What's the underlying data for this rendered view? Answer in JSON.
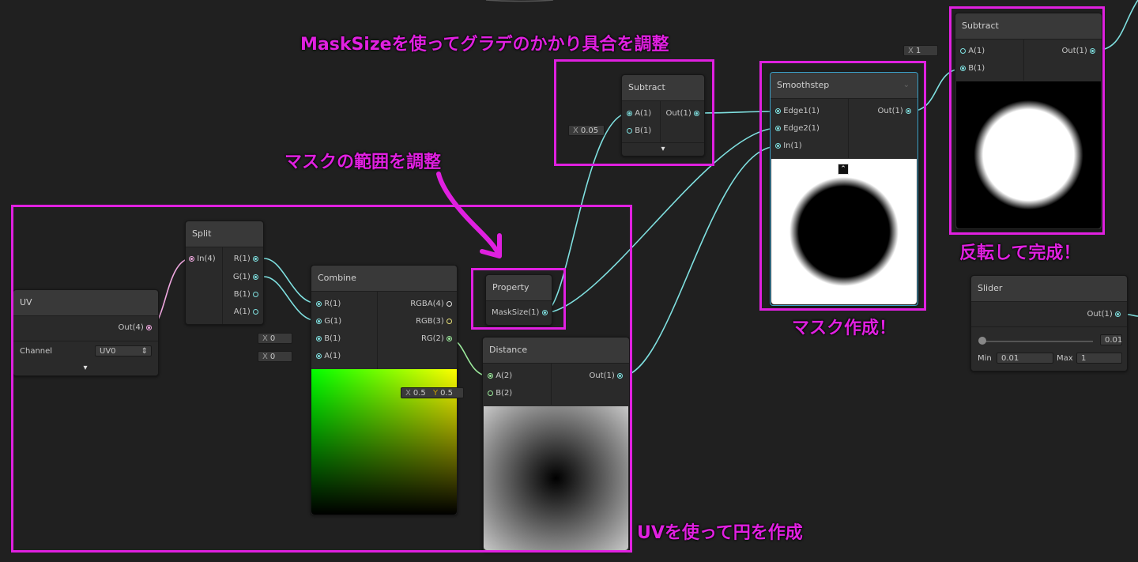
{
  "annotations": {
    "top": "MaskSizeを使ってグラデのかかり具合を調整",
    "mid": "マスクの範囲を調整",
    "bottom": "UVを使って円を作成",
    "mask": "マスク作成！",
    "invert": "反転して完成！"
  },
  "nodes": {
    "uv": {
      "title": "UV",
      "out": "Out(4)",
      "channel_label": "Channel",
      "channel_value": "UV0"
    },
    "split": {
      "title": "Split",
      "in": "In(4)",
      "outs": [
        "R(1)",
        "G(1)",
        "B(1)",
        "A(1)"
      ]
    },
    "combine": {
      "title": "Combine",
      "ins": [
        "R(1)",
        "G(1)",
        "B(1)",
        "A(1)"
      ],
      "outs": [
        "RGBA(4)",
        "RGB(3)",
        "RG(2)"
      ],
      "b_default": "0",
      "a_default": "0"
    },
    "property": {
      "title": "Property",
      "out": "MaskSize(1)"
    },
    "distance": {
      "title": "Distance",
      "ins": [
        "A(2)",
        "B(2)"
      ],
      "out": "Out(1)",
      "b_x": "0.5",
      "b_y": "0.5"
    },
    "subtract1": {
      "title": "Subtract",
      "ins": [
        "A(1)",
        "B(1)"
      ],
      "out": "Out(1)",
      "b_default": "0.05"
    },
    "smoothstep": {
      "title": "Smoothstep",
      "ins": [
        "Edge1(1)",
        "Edge2(1)",
        "In(1)"
      ],
      "out": "Out(1)"
    },
    "subtract2": {
      "title": "Subtract",
      "ins": [
        "A(1)",
        "B(1)"
      ],
      "out": "Out(1)",
      "a_default": "1"
    },
    "slider": {
      "title": "Slider",
      "out": "Out(1)",
      "value": "0.01",
      "min_label": "Min",
      "min": "0.01",
      "max_label": "Max",
      "max": "1"
    }
  },
  "field_labels": {
    "x": "X",
    "y": "Y"
  },
  "colors": {
    "annotation": "#e020e0",
    "wire": "#7fe0e0",
    "uv_wire": "#f0a8e0",
    "background": "#202020"
  }
}
